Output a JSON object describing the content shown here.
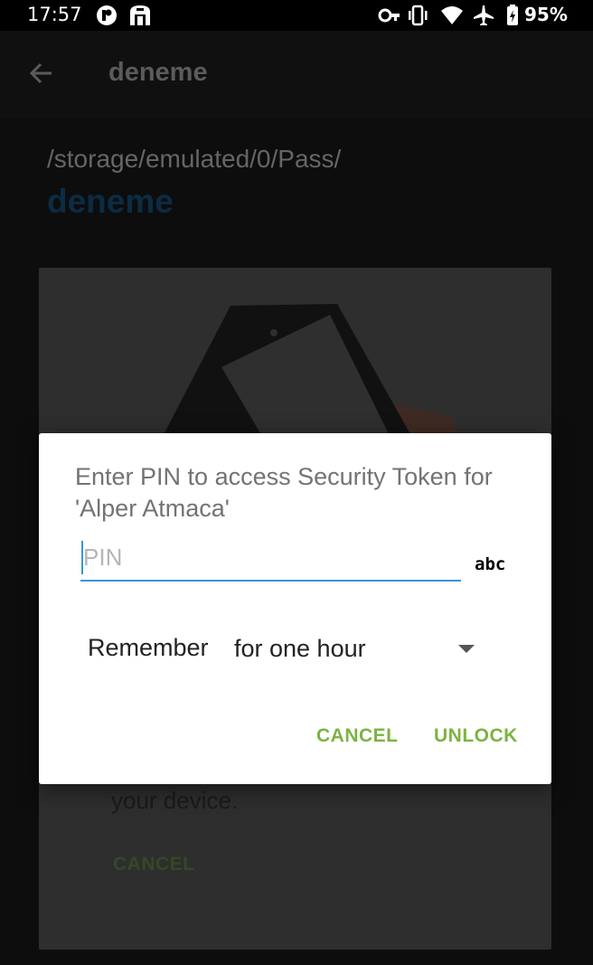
{
  "status_bar": {
    "time": "17:57",
    "battery_percent": "95%",
    "icons_left": [
      "app-notification-icon",
      "app-notification-icon"
    ],
    "icons_right": [
      "vpn-key-icon",
      "vibrate-icon",
      "wifi-icon",
      "airplane-mode-icon",
      "battery-charging-icon"
    ]
  },
  "app_bar": {
    "back_icon": "back-arrow-icon",
    "title": "deneme"
  },
  "content": {
    "path": "/storage/emulated/0/Pass/",
    "entry_name": "deneme",
    "card_text": "your device.",
    "card_cancel": "CANCEL"
  },
  "dialog": {
    "message": "Enter PIN to access Security Token for 'Alper Atmaca'",
    "pin_placeholder": "PIN",
    "keyboard_toggle": "abc",
    "remember_label": "Remember",
    "remember_value": "for one hour",
    "cancel_label": "CANCEL",
    "unlock_label": "UNLOCK"
  },
  "colors": {
    "accent": "#7cb342",
    "input_underline": "#3896d6",
    "scrim_background": "#0d0d0d"
  }
}
